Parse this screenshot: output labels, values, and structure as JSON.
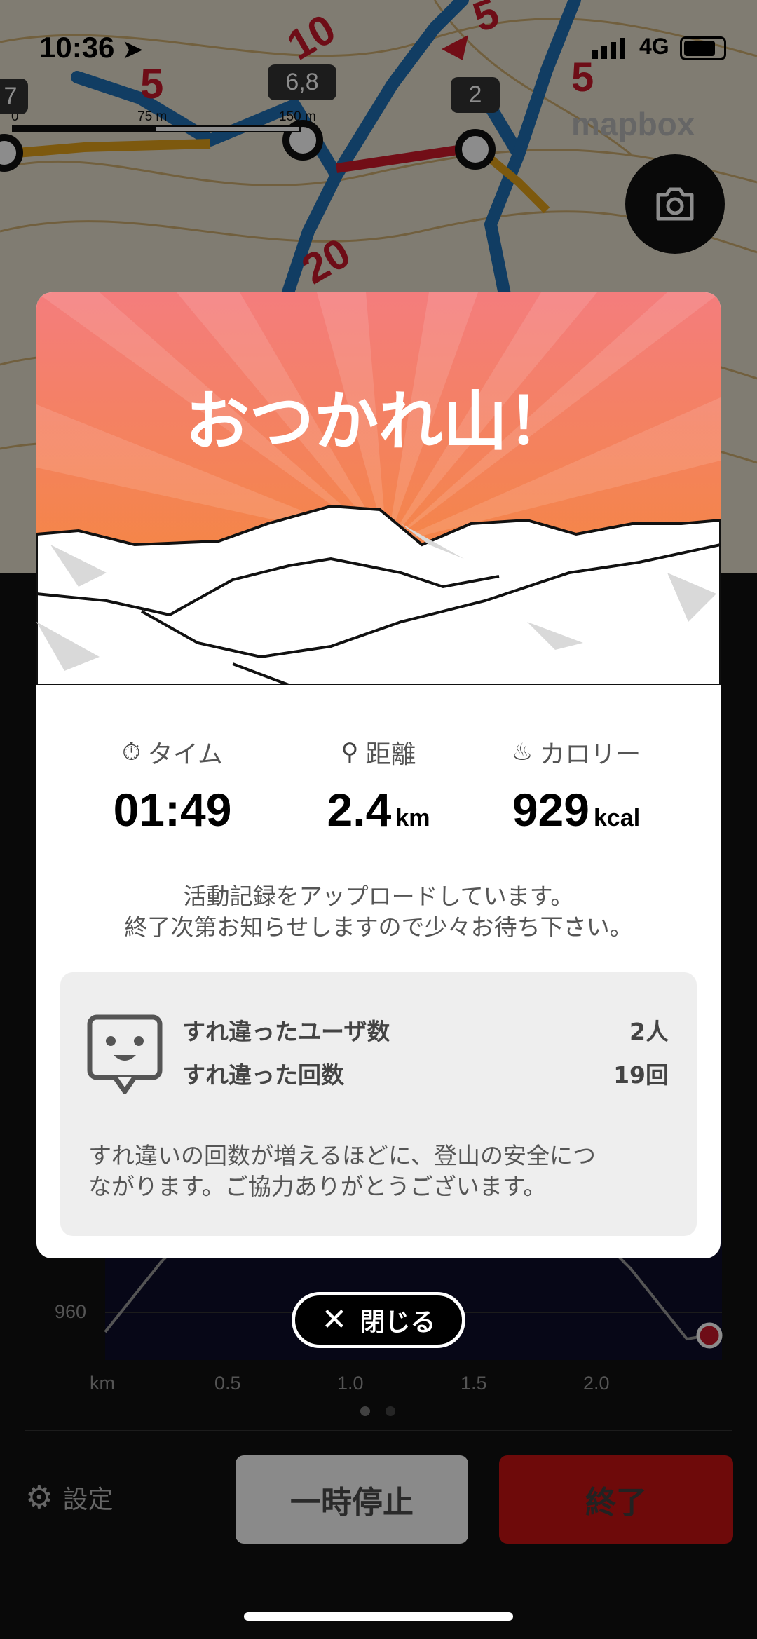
{
  "status_bar": {
    "time": "10:36",
    "network": "4G"
  },
  "map": {
    "scale_labels": [
      "0",
      "75 m",
      "150 m"
    ],
    "waypoint_tags": [
      "7",
      "6,8",
      "2"
    ],
    "contour_labels": [
      "10",
      "5",
      "5",
      "5",
      "20"
    ],
    "logo": "mapbox"
  },
  "modal": {
    "title": "おつかれ山！",
    "stats": [
      {
        "label": "タイム",
        "value": "01:49",
        "unit": ""
      },
      {
        "label": "距離",
        "value": "2.4",
        "unit": "km"
      },
      {
        "label": "カロリー",
        "value": "929",
        "unit": "kcal"
      }
    ],
    "upload_message_line1": "活動記録をアップロードしています。",
    "upload_message_line2": "終了次第お知らせしますので少々お待ち下さい。",
    "encounter": {
      "users_label": "すれ違ったユーザ数",
      "users_value": "2人",
      "count_label": "すれ違った回数",
      "count_value": "19回",
      "footer_line1": "すれ違いの回数が増えるほどに、登山の安全につ",
      "footer_line2": "ながります。ご協力ありがとうございます。"
    }
  },
  "close_button": {
    "label": "閉じる"
  },
  "elevation_chart": {
    "y_label": "960",
    "x_labels": [
      "km",
      "0.5",
      "1.0",
      "1.5",
      "2.0"
    ]
  },
  "bottom_bar": {
    "settings_label": "設定",
    "pause_label": "一時停止",
    "end_label": "終了"
  },
  "colors": {
    "title_gradient_top": "#f47d7d",
    "title_gradient_bottom": "#f58a2c",
    "end_button": "#6e0a0a"
  }
}
